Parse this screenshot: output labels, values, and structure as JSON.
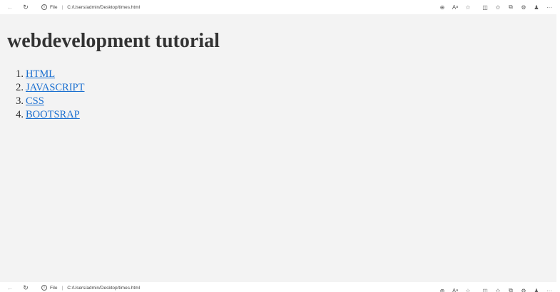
{
  "browser": {
    "back_icon": "←",
    "reload_icon": "↻",
    "info_icon": "i",
    "scheme_label": "File",
    "separator": "|",
    "url": "C:/Users/admin/Desktop/times.html",
    "bottom_url_partial": "C:/Users/admin/Desktop/times.html",
    "toolbar_icons": {
      "zoom": "⊕",
      "read_aloud": "Aᵃ",
      "favorite": "☆",
      "split_screen": "◫",
      "favorites": "✩",
      "collections": "⧉",
      "extensions": "⚙",
      "profile": "♟",
      "more": "···"
    }
  },
  "page": {
    "heading": "webdevelopment tutorial",
    "links": [
      {
        "number": "1.",
        "label": "HTML"
      },
      {
        "number": "2.",
        "label": "JAVASCRIPT"
      },
      {
        "number": "3.",
        "label": "CSS"
      },
      {
        "number": "4.",
        "label": "BOOTSRAP"
      }
    ]
  }
}
